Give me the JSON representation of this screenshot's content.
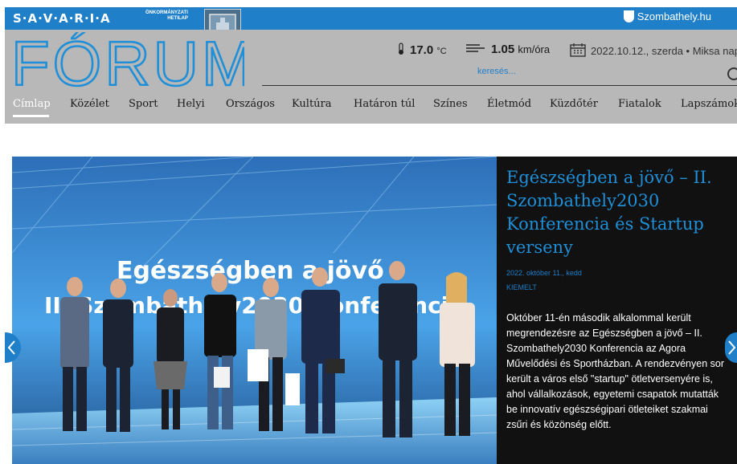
{
  "topbar": {
    "brand": "S·A·V·A·R·I·A",
    "brand_sub_1": "ÖNKORMÁNYZATI",
    "brand_sub_2": "HETILAP",
    "site_link": "Szombathely.hu"
  },
  "header": {
    "logo_text": "FÓRUM",
    "temperature": "17.0",
    "temperature_unit": "°C",
    "wind": "1.05",
    "wind_unit": "km/óra",
    "date": "2022.10.12., szerda",
    "nameday": "Miksa nap",
    "search_placeholder": "keresés..."
  },
  "nav": {
    "items": [
      "Címlap",
      "Közélet",
      "Sport",
      "Helyi",
      "Országos",
      "Kultúra",
      "Határon túl",
      "Színes",
      "Életmód",
      "Küzdőtér",
      "Fiatalok",
      "Lapszámok"
    ]
  },
  "hero": {
    "banner_line1": "Egészségben a jövő",
    "banner_line2": "II. Szombathely2030 Konferencia",
    "title": "Egészségben a jövő – II. Szombathely2030 Konferencia és Startup verseny",
    "date": "2022. október 11., kedd",
    "tag": "KIEMELT",
    "text": "Október 11-én második alkalommal került megrendezésre az Egészségben a jövő – II. Szombathely2030 Konferencia az Agora Művelődési és Sportházban. A rendezvényen sor került a város első \"startup\" ötletversenyére is, ahol vállalkozások, egyetemi csapatok mutatták be innovatív egészségipari ötleteiket szakmai zsűri és közönség előtt."
  },
  "colors": {
    "accent": "#1f7fc9",
    "header_bg": "#b8b8b8",
    "panel_bg": "#111111"
  }
}
